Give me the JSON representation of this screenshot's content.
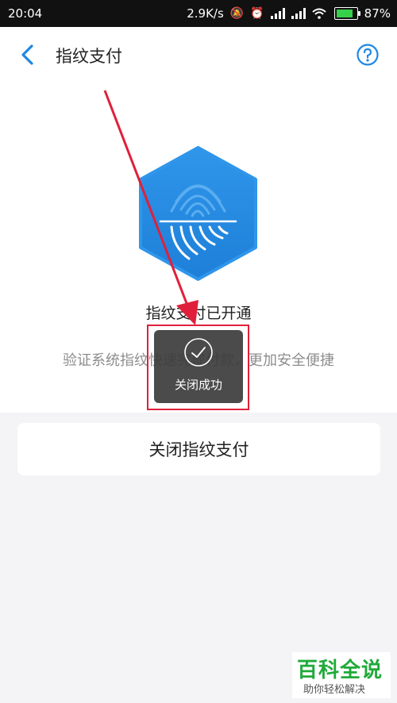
{
  "status_bar": {
    "time": "20:04",
    "speed": "2.9K/s",
    "battery": "87%",
    "icons": [
      "mute-icon",
      "alarm-icon",
      "signal-icon",
      "signal-icon",
      "wifi-icon",
      "battery-icon"
    ]
  },
  "header": {
    "title": "指纹支付",
    "back_icon": "chevron-left-icon",
    "help_icon": "help-circle-icon"
  },
  "main": {
    "status_text": "指纹支付已开通",
    "description": "验证系统指纹快速完成付款，更加安全便捷",
    "fingerprint_icon": "fingerprint-hexagon-icon"
  },
  "toast": {
    "text": "关闭成功",
    "icon": "check-circle-icon"
  },
  "actions": {
    "disable_label": "关闭指纹支付"
  },
  "watermark": {
    "main": "百科全说",
    "sub": "助你轻松解决"
  },
  "colors": {
    "accent": "#1e88e5",
    "highlight": "#e0203a",
    "toast_bg": "#3c3c3c",
    "watermark": "#1faa3a"
  }
}
